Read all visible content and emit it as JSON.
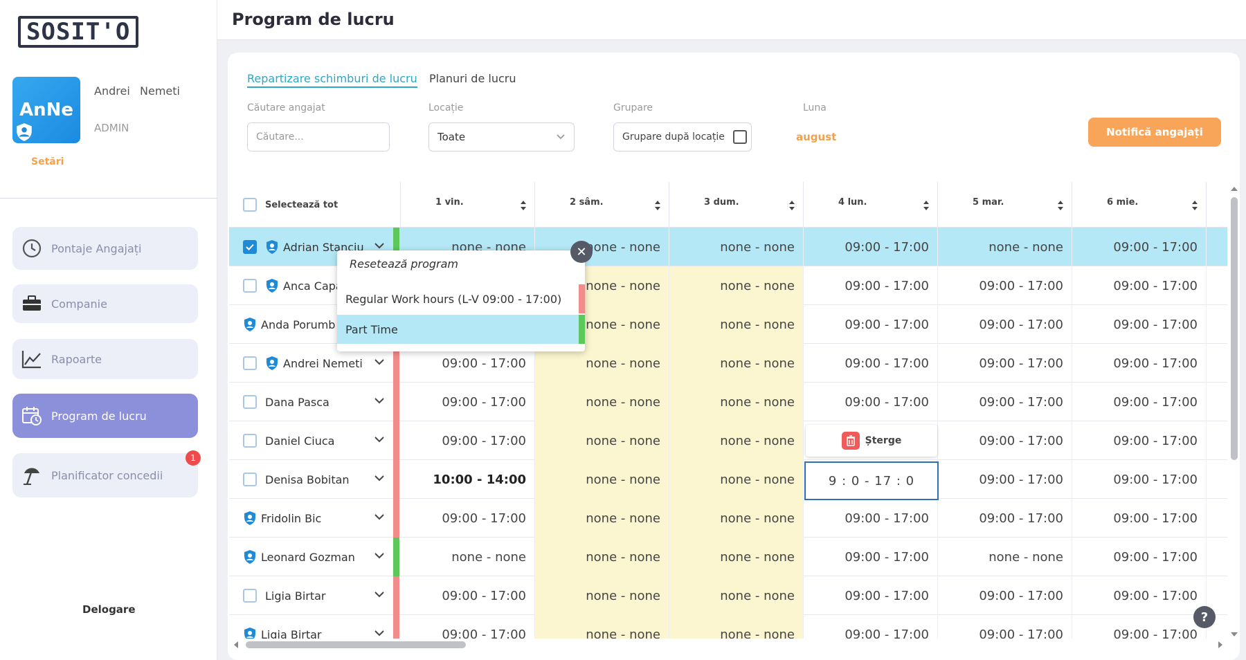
{
  "app": {
    "logo_text": "SOSIT'O",
    "page_title": "Program de lucru"
  },
  "user": {
    "initials": "AnNe",
    "first_name": "Andrei",
    "last_name": "Nemeti",
    "role": "ADMIN",
    "settings_label": "Setări"
  },
  "nav": [
    {
      "label": "Pontaje Angajați",
      "icon": "clock-history-icon"
    },
    {
      "label": "Companie",
      "icon": "briefcase-icon"
    },
    {
      "label": "Rapoarte",
      "icon": "chart-line-icon"
    },
    {
      "label": "Program de lucru",
      "icon": "calendar-clock-icon",
      "active": true
    },
    {
      "label": "Planificator concedii",
      "icon": "beach-umbrella-icon",
      "badge": "1"
    }
  ],
  "logout_label": "Delogare",
  "tabs": {
    "active": "Repartizare schimburi de lucru",
    "inactive": "Planuri de lucru"
  },
  "filters": {
    "search_label": "Căutare angajat",
    "search_placeholder": "Căutare...",
    "location_label": "Locație",
    "location_value": "Toate",
    "group_label": "Grupare",
    "group_value": "Grupare după locație",
    "month_label": "Luna",
    "month_value": "august"
  },
  "notify_label": "Notifică angajați",
  "table": {
    "select_all_label": "Selectează tot",
    "days": [
      "1 vin.",
      "2 sâm.",
      "3 dum.",
      "4 lun.",
      "5 mar.",
      "6 mie."
    ],
    "rows": [
      {
        "name": "Adrian Stanciu",
        "cells": [
          "none - none",
          "none - none",
          "none - none",
          "09:00 - 17:00",
          "none - none",
          "09:00 - 17:00"
        ]
      },
      {
        "name": "Anca Capa",
        "cells": [
          "",
          "none - none",
          "none - none",
          "09:00 - 17:00",
          "09:00 - 17:00",
          "09:00 - 17:00"
        ]
      },
      {
        "name": "Anda Porumb",
        "cells": [
          "",
          "none - none",
          "none - none",
          "09:00 - 17:00",
          "09:00 - 17:00",
          "09:00 - 17:00"
        ]
      },
      {
        "name": "Andrei Nemeti",
        "cells": [
          "09:00 - 17:00",
          "none - none",
          "none - none",
          "09:00 - 17:00",
          "09:00 - 17:00",
          "09:00 - 17:00"
        ]
      },
      {
        "name": "Dana Pasca",
        "cells": [
          "09:00 - 17:00",
          "none - none",
          "none - none",
          "09:00 - 17:00",
          "09:00 - 17:00",
          "09:00 - 17:00"
        ]
      },
      {
        "name": "Daniel Ciuca",
        "cells": [
          "09:00 - 17:00",
          "none - none",
          "none - none",
          "",
          "09:00 - 17:00",
          "09:00 - 17:00"
        ]
      },
      {
        "name": "Denisa Bobitan",
        "cells": [
          "10:00 - 14:00",
          "none - none",
          "none - none",
          "",
          "09:00 - 17:00",
          "09:00 - 17:00"
        ]
      },
      {
        "name": "Fridolin Bic",
        "cells": [
          "09:00 - 17:00",
          "none - none",
          "none - none",
          "09:00 - 17:00",
          "09:00 - 17:00",
          "09:00 - 17:00"
        ]
      },
      {
        "name": "Leonard Gozman",
        "cells": [
          "none - none",
          "none - none",
          "none - none",
          "09:00 - 17:00",
          "none - none",
          "09:00 - 17:00"
        ]
      },
      {
        "name": "Ligia Birtar",
        "cells": [
          "09:00 - 17:00",
          "none - none",
          "none - none",
          "09:00 - 17:00",
          "09:00 - 17:00",
          "09:00 - 17:00"
        ]
      },
      {
        "name": "Ligia Birtar",
        "cells": [
          "09:00 - 17:00",
          "none - none",
          "none - none",
          "09:00 - 17:00",
          "09:00 - 17:00",
          "09:00 - 17:00"
        ]
      }
    ]
  },
  "popup": {
    "title": "Resetează program",
    "options": [
      "Regular Work hours (L-V 09:00 - 17:00)",
      "Part Time"
    ]
  },
  "delete_label": "Șterge",
  "edit_value": "9 : 0 - 17 : 0",
  "colors": {
    "accent": "#2aa7c9",
    "orange": "#f8a55a",
    "active_nav": "#8c8fd9",
    "selected_row": "#b4e8f6",
    "weekend": "#fbf6cf",
    "red_status": "#f28b8b",
    "green_status": "#5cc85a"
  }
}
